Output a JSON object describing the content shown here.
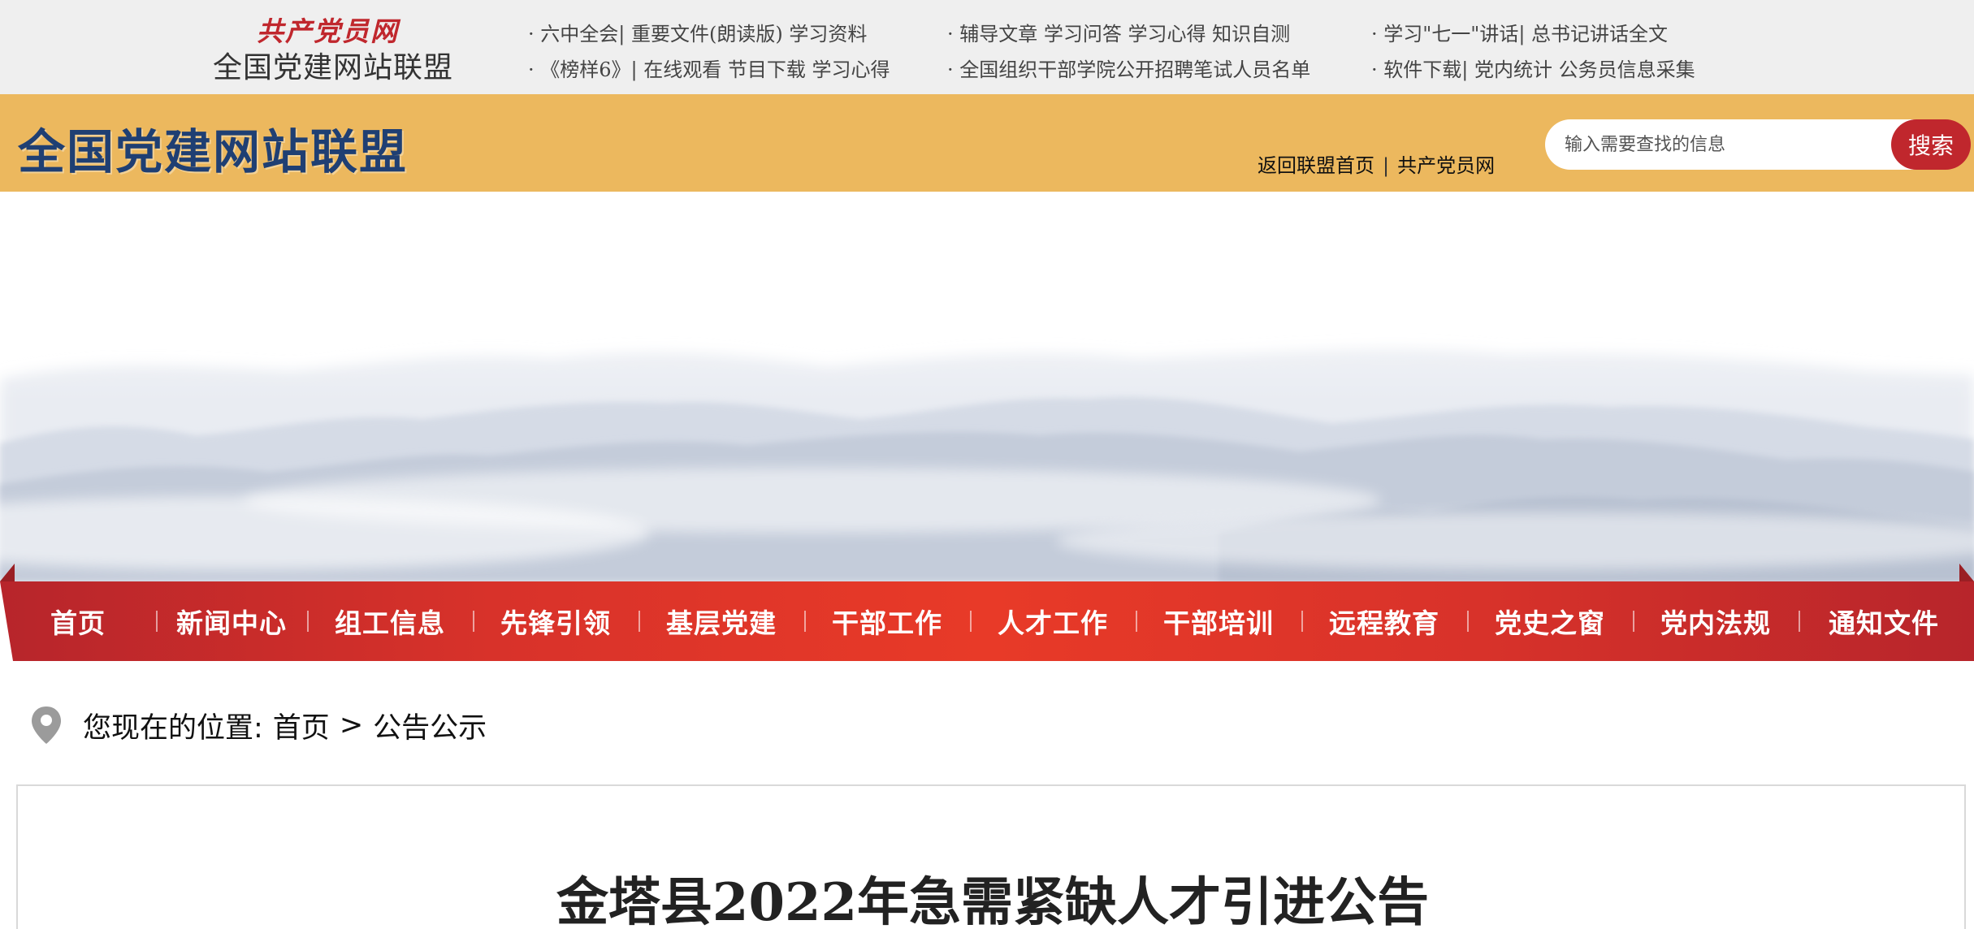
{
  "topbar": {
    "logo_script": "共产党员网",
    "logo_name": "全国党建网站联盟",
    "links_row1": [
      "· 六中全会| 重要文件(朗读版) 学习资料",
      "· 辅导文章 学习问答 学习心得 知识自测",
      "· 学习\"七一\"讲话| 总书记讲话全文"
    ],
    "links_row2": [
      "· 《榜样6》| 在线观看 节目下载 学习心得",
      "· 全国组织干部学院公开招聘笔试人员名单",
      "· 软件下载| 党内统计 公务员信息采集"
    ]
  },
  "header": {
    "title": "全国党建网站联盟",
    "link_home": "返回联盟首页",
    "link_sep": "|",
    "link_party": "共产党员网",
    "search_placeholder": "输入需要查找的信息",
    "search_button": "搜索"
  },
  "nav": {
    "items": [
      "首页",
      "新闻中心",
      "组工信息",
      "先锋引领",
      "基层党建",
      "干部工作",
      "人才工作",
      "干部培训",
      "远程教育",
      "党史之窗",
      "党内法规",
      "通知文件"
    ]
  },
  "breadcrumb": {
    "prefix": "您现在的位置:",
    "home": "首页",
    "arrow": ">",
    "current": "公告公示"
  },
  "article": {
    "title": "金塔县2022年急需紧缺人才引进公告"
  },
  "colors": {
    "header_bg": "#ecb85e",
    "header_title": "#1f3f73",
    "accent_red": "#c0272d",
    "nav_red": "#e83a28",
    "topbar_bg": "#efefef"
  }
}
